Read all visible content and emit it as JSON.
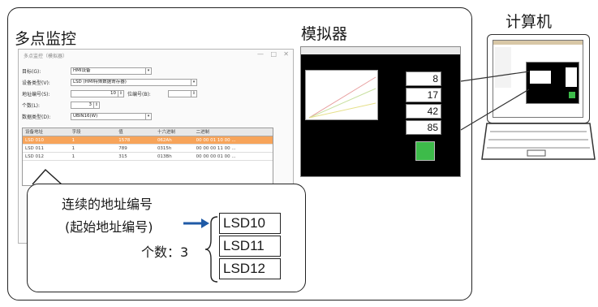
{
  "multi_monitor": {
    "heading": "多点监控",
    "window": {
      "title": "多点监控（模拟器）",
      "fields": [
        {
          "label": "目标(G):",
          "value": "HMI设备"
        },
        {
          "label": "设备类型(V):",
          "value": "LSD (HMI特殊数据寄存器)"
        },
        {
          "label": "地址编号(S):",
          "value": "10",
          "extra_label": "位编号(B):",
          "extra_value": ""
        },
        {
          "label": "个数(L):",
          "value": "3"
        },
        {
          "label": "数据类型(D):",
          "value": "UBIN16(W)"
        }
      ],
      "columns": [
        "设备地址",
        "字段",
        "值",
        "十六进制",
        "二进制"
      ],
      "rows": [
        {
          "addr": "LSD 010",
          "field": "1",
          "value": "1578",
          "hex": "062Ah",
          "bin": "00 00 01 10 00 ..."
        },
        {
          "addr": "LSD 011",
          "field": "1",
          "value": "789",
          "hex": "0315h",
          "bin": "00 00 00 11 00 ..."
        },
        {
          "addr": "LSD 012",
          "field": "1",
          "value": "315",
          "hex": "013Bh",
          "bin": "00 00 00 01 00 ..."
        }
      ]
    }
  },
  "callout": {
    "line1": "连续的地址编号",
    "line2": "(起始地址编号)",
    "count_label": "个数：3",
    "addresses": [
      "LSD10",
      "LSD11",
      "LSD12"
    ]
  },
  "simulator": {
    "heading": "模拟器",
    "values": [
      "8",
      "17",
      "42",
      "85"
    ]
  },
  "computer": {
    "heading": "计算机"
  },
  "colors": {
    "accent_arrow": "#1f5aa6",
    "selected_row": "#f7a45a",
    "sim_green": "#3dbb4a"
  }
}
